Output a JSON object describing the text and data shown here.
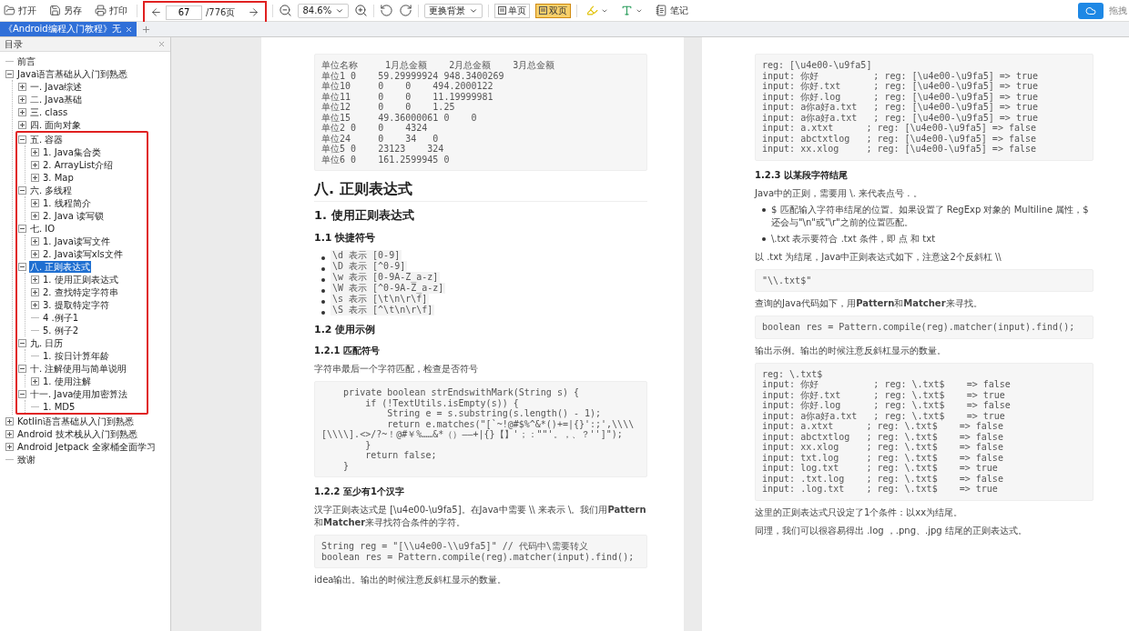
{
  "toolbar": {
    "open": "打开",
    "save_as": "另存",
    "print": "打印",
    "page_input": "67",
    "page_total": "/776页",
    "nav_highlighted": true,
    "zoom": "84.6%",
    "background_select": "更换背景",
    "view_modes": [
      {
        "label": "单页",
        "selected": false
      },
      {
        "label": "双页",
        "selected": true
      }
    ],
    "note": "笔记",
    "drag_label": "拖拽"
  },
  "tabs": [
    {
      "label": "《Android编程入门教程》无",
      "selected": true
    }
  ],
  "sidebar": {
    "title": "目录",
    "tree": [
      {
        "kind": "leaf",
        "label": "前言",
        "selected": false
      },
      {
        "kind": "node",
        "label": "Java语言基础从入门到熟悉",
        "expanded": true,
        "selected": false,
        "children": [
          {
            "kind": "node",
            "label": "一. Java综述",
            "expanded": false,
            "selected": false
          },
          {
            "kind": "node",
            "label": "二. Java基础",
            "expanded": false,
            "selected": false
          },
          {
            "kind": "node",
            "label": "三. class",
            "expanded": false,
            "selected": false
          },
          {
            "kind": "node",
            "label": "四. 面向对象",
            "expanded": false,
            "selected": false
          },
          {
            "kind": "marked_group",
            "children": [
              {
                "kind": "node",
                "label": "五. 容器",
                "expanded": true,
                "selected": false,
                "children": [
                  {
                    "kind": "node",
                    "label": "1. Java集合类",
                    "expanded": false,
                    "selected": false
                  },
                  {
                    "kind": "node",
                    "label": "2. ArrayList介绍",
                    "expanded": false,
                    "selected": false
                  },
                  {
                    "kind": "node",
                    "label": "3. Map",
                    "expanded": false,
                    "selected": false
                  }
                ]
              },
              {
                "kind": "node",
                "label": "六. 多线程",
                "expanded": true,
                "selected": false,
                "children": [
                  {
                    "kind": "node",
                    "label": "1. 线程简介",
                    "expanded": false,
                    "selected": false
                  },
                  {
                    "kind": "node",
                    "label": "2. Java 读写锁",
                    "expanded": false,
                    "selected": false
                  }
                ]
              },
              {
                "kind": "node",
                "label": "七. IO",
                "expanded": true,
                "selected": false,
                "children": [
                  {
                    "kind": "node",
                    "label": "1. Java读写文件",
                    "expanded": false,
                    "selected": false
                  },
                  {
                    "kind": "node",
                    "label": "2. Java读写xls文件",
                    "expanded": false,
                    "selected": false
                  }
                ]
              },
              {
                "kind": "node",
                "label": "八. 正则表达式",
                "expanded": true,
                "selected": true,
                "children": [
                  {
                    "kind": "node",
                    "label": "1. 使用正则表达式",
                    "expanded": false,
                    "selected": false
                  },
                  {
                    "kind": "node",
                    "label": "2. 查找特定字符串",
                    "expanded": false,
                    "selected": false
                  },
                  {
                    "kind": "node",
                    "label": "3. 提取特定字符",
                    "expanded": false,
                    "selected": false
                  },
                  {
                    "kind": "leaf",
                    "label": "4 .例子1",
                    "selected": false
                  },
                  {
                    "kind": "leaf",
                    "label": "5. 例子2",
                    "selected": false
                  }
                ]
              },
              {
                "kind": "node",
                "label": "九. 日历",
                "expanded": true,
                "selected": false,
                "children": [
                  {
                    "kind": "leaf",
                    "label": "1. 按日计算年龄",
                    "selected": false
                  }
                ]
              },
              {
                "kind": "node",
                "label": "十. 注解使用与简单说明",
                "expanded": true,
                "selected": false,
                "children": [
                  {
                    "kind": "node",
                    "label": "1. 使用注解",
                    "expanded": false,
                    "selected": false
                  }
                ]
              },
              {
                "kind": "node",
                "label": "十一. Java使用加密算法",
                "expanded": true,
                "selected": false,
                "children": [
                  {
                    "kind": "leaf",
                    "label": "1. MD5",
                    "selected": false
                  }
                ]
              }
            ]
          }
        ]
      },
      {
        "kind": "node",
        "label": "Kotlin语言基础从入门到熟悉",
        "expanded": false,
        "selected": false
      },
      {
        "kind": "node",
        "label": "Android 技术栈从入门到熟悉",
        "expanded": false,
        "selected": false
      },
      {
        "kind": "node",
        "label": "Android Jetpack 全家桶全面学习",
        "expanded": false,
        "selected": false
      },
      {
        "kind": "leaf",
        "label": "致谢",
        "selected": false
      }
    ]
  },
  "pages": [
    {
      "blocks": [
        {
          "kind": "code",
          "lines": [
            "单位名称     1月总金额    2月总金额    3月总金额",
            "单位1 0    59.29999924 948.3400269",
            "单位10     0    0    494.2000122",
            "单位11     0    0    11.19999981",
            "单位12     0    0    1.25",
            "单位15     49.36000061 0    0",
            "单位2 0    0    4324",
            "单位24     0    34   0",
            "单位5 0    23123    324",
            "单位6 0    161.2599945 0"
          ]
        },
        {
          "kind": "h1",
          "text": "八. 正则表达式"
        },
        {
          "kind": "h2",
          "text": "1. 使用正则表达式"
        },
        {
          "kind": "h3",
          "text": "1.1 快捷符号"
        },
        {
          "kind": "chips",
          "items": [
            "\\d 表示 [0-9]",
            "\\D 表示 [^0-9]",
            "\\w 表示 [0-9A-Z_a-z]",
            "\\W 表示 [^0-9A-Z_a-z]",
            "\\s 表示 [\\t\\n\\r\\f]",
            "\\S 表示 [^\\t\\n\\r\\f]"
          ]
        },
        {
          "kind": "h3",
          "text": "1.2 使用示例"
        },
        {
          "kind": "h4",
          "text": "1.2.1 匹配符号"
        },
        {
          "kind": "p",
          "text": "字符串最后一个字符匹配，检查是否符号"
        },
        {
          "kind": "code",
          "lines": [
            "    private boolean strEndswithMark(String s) {",
            "        if (!TextUtils.isEmpty(s)) {",
            "            String e = s.substring(s.length() - 1);",
            "            return e.matches(\"[`~!@#$%^&*()+=|{}':;',\\\\\\\\[\\\\\\\\].<>/?~！@#￥%……&*（）——+|{}【】'；：\"\"'。，、？'']\");",
            "        }",
            "        return false;",
            "    }"
          ]
        },
        {
          "kind": "h4",
          "text": "1.2.2 至少有1个汉字"
        },
        {
          "kind": "p",
          "text": "汉字正则表达式是 [\\u4e00-\\u9fa5]。在Java中需要 \\\\ 来表示 \\。我们用**Pattern**和**Matcher**来寻找符合条件的字符。"
        },
        {
          "kind": "code",
          "lines": [
            "String reg = \"[\\\\u4e00-\\\\u9fa5]\" // 代码中\\需要转义",
            "boolean res = Pattern.compile(reg).matcher(input).find();"
          ]
        },
        {
          "kind": "p",
          "text": "idea输出。输出的时候注意反斜杠显示的数量。"
        }
      ]
    },
    {
      "blocks": [
        {
          "kind": "code",
          "lines": [
            "reg: [\\u4e00-\\u9fa5]",
            "input: 你好          ; reg: [\\u4e00-\\u9fa5] => true",
            "input: 你好.txt      ; reg: [\\u4e00-\\u9fa5] => true",
            "input: 你好.log      ; reg: [\\u4e00-\\u9fa5] => true",
            "input: a你a好a.txt   ; reg: [\\u4e00-\\u9fa5] => true",
            "input: a你a好a.txt   ; reg: [\\u4e00-\\u9fa5] => true",
            "input: a.xtxt      ; reg: [\\u4e00-\\u9fa5] => false",
            "input: abctxtlog   ; reg: [\\u4e00-\\u9fa5] => false",
            "input: xx.xlog     ; reg: [\\u4e00-\\u9fa5] => false"
          ]
        },
        {
          "kind": "h4",
          "text": "1.2.3 以某段字符结尾"
        },
        {
          "kind": "p",
          "text": "Java中的正则，需要用 \\. 来代表点号 . 。"
        },
        {
          "kind": "bullets",
          "items": [
            "$ 匹配输入字符串结尾的位置。如果设置了 RegExp 对象的 Multiline 属性，$ 还会与\"\\n\"或\"\\r\"之前的位置匹配。",
            "\\.txt 表示要符合 .txt 条件，即 点 和 txt"
          ]
        },
        {
          "kind": "p",
          "text": "以 .txt 为结尾，Java中正则表达式如下，注意这2个反斜杠 \\\\"
        },
        {
          "kind": "code",
          "lines": [
            "\"\\\\.txt$\""
          ]
        },
        {
          "kind": "p",
          "text": "查询的Java代码如下，用**Pattern**和**Matcher**来寻找。"
        },
        {
          "kind": "code",
          "lines": [
            "boolean res = Pattern.compile(reg).matcher(input).find();"
          ]
        },
        {
          "kind": "p",
          "text": "输出示例。输出的时候注意反斜杠显示的数量。"
        },
        {
          "kind": "code",
          "lines": [
            "reg: \\.txt$",
            "input: 你好          ; reg: \\.txt$    => false",
            "input: 你好.txt      ; reg: \\.txt$    => true",
            "input: 你好.log      ; reg: \\.txt$    => false",
            "input: a你a好a.txt   ; reg: \\.txt$    => true",
            "input: a.xtxt      ; reg: \\.txt$    => false",
            "input: abctxtlog   ; reg: \\.txt$    => false",
            "input: xx.xlog     ; reg: \\.txt$    => false",
            "input: txt.log     ; reg: \\.txt$    => false",
            "input: log.txt     ; reg: \\.txt$    => true",
            "input: .txt.log    ; reg: \\.txt$    => false",
            "input: .log.txt    ; reg: \\.txt$    => true"
          ]
        },
        {
          "kind": "p",
          "text": "这里的正则表达式只设定了1个条件：以xx为结尾。"
        },
        {
          "kind": "p",
          "text": "同理，我们可以很容易得出 .log ，.png、.jpg 结尾的正则表达式。"
        }
      ]
    }
  ]
}
